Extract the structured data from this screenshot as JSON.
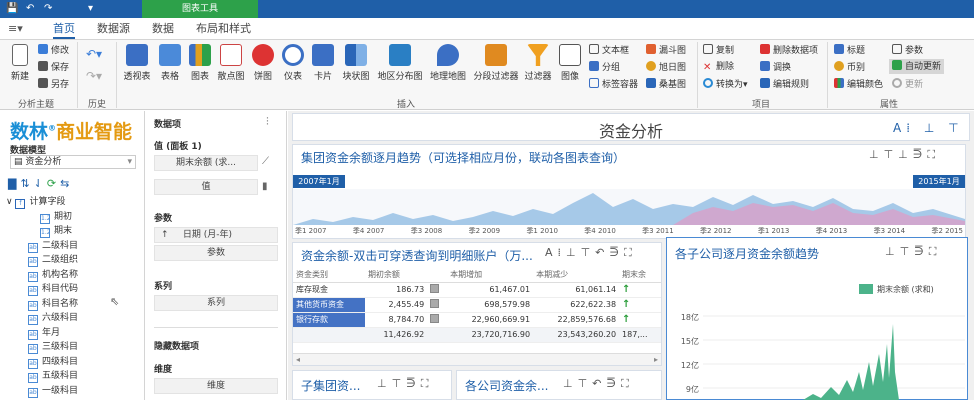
{
  "titlebar": {
    "context_tab": "图表工具",
    "quick_access": [
      "💾",
      "↶",
      "↷",
      "▾"
    ]
  },
  "tabs": [
    "文件",
    "首页",
    "数据源",
    "数据",
    "布局和样式"
  ],
  "ribbon": {
    "groups": [
      "分析主题",
      "历史",
      "插入",
      "项目",
      "属性"
    ],
    "analysis": {
      "new": "新建",
      "modify": "修改",
      "save": "保存",
      "save_as": "另存"
    },
    "insert_big": [
      "透视表",
      "表格",
      "图表",
      "散点图",
      "饼图",
      "仪表",
      "卡片",
      "块状图",
      "地区分布图",
      "地理地图",
      "分段过滤器",
      "过滤器",
      "图像"
    ],
    "insert_small": [
      "文本框",
      "漏斗图",
      "复制",
      "删除数据项",
      "分组",
      "旭日图",
      "删除",
      "调换",
      "标签容器",
      "桑基图",
      "转换为",
      "编辑规则"
    ],
    "props": [
      "标题",
      "参数",
      "币别",
      "自动更新",
      "编辑颜色",
      "更新"
    ]
  },
  "left": {
    "logo": "数林",
    "logo_sub": "商业智能",
    "reg": "®",
    "model_label": "数据模型",
    "model_value": "资金分析",
    "calc_folder": "计算字段",
    "fields": [
      "期初",
      "期末",
      "二级科目",
      "二级组织",
      "机构名称",
      "科目代码",
      "科目名称",
      "六级科目",
      "年月",
      "三级科目",
      "四级科目",
      "五级科目",
      "一级科目"
    ]
  },
  "mid": {
    "items_label": "数据项",
    "values_label": "值 (面板 1)",
    "values_field": "期末余额 (求...",
    "values_btn": "值",
    "params_label": "参数",
    "params_field": "日期 (月-年)",
    "params_btn": "参数",
    "series_label": "系列",
    "series_btn": "系列",
    "hidden_label": "隐藏数据项",
    "dim_label": "维度",
    "dim_btn": "维度"
  },
  "dashboard": {
    "title": "资金分析",
    "trend": {
      "title": "集团资金余额逐月趋势（可选择相应月份，联动各图表查询）",
      "range_start": "2007年1月",
      "range_end": "2015年1月",
      "ticks": [
        "季1 2007",
        "季4 2007",
        "季3 2008",
        "季2 2009",
        "季1 2010",
        "季4 2010",
        "季3 2011",
        "季2 2012",
        "季1 2013",
        "季4 2013",
        "季3 2014",
        "季2 2015"
      ]
    },
    "pivot": {
      "title": "资金余额-双击可穿透查询到明细账户（万...",
      "headers": [
        "资金类别",
        "期初余额",
        "本期增加",
        "本期减少",
        "期末余"
      ],
      "rows": [
        [
          "库存现金",
          "186.73",
          "61,467.01",
          "61,061.14"
        ],
        [
          "其他货币资金",
          "2,455.49",
          "698,579.98",
          "622,622.38"
        ],
        [
          "银行存款",
          "8,784.70",
          "22,960,669.91",
          "22,859,576.68"
        ]
      ],
      "total": [
        "",
        "11,426.92",
        "23,720,716.90",
        "23,543,260.20",
        "187,..."
      ]
    },
    "sub1": {
      "title": "子集团资..."
    },
    "sub2": {
      "title": "各公司资金余..."
    },
    "monthly": {
      "title": "各子公司逐月资金余额趋势",
      "legend": "期末余额 (求和)",
      "yticks": [
        "18亿",
        "15亿",
        "12亿",
        "9亿"
      ]
    }
  },
  "chart_data": {
    "type": "area",
    "title": "各子公司逐月资金余额趋势",
    "series": [
      {
        "name": "期末余额 (求和)"
      }
    ],
    "yticks": [
      "18亿",
      "15亿",
      "12亿",
      "9亿"
    ]
  }
}
